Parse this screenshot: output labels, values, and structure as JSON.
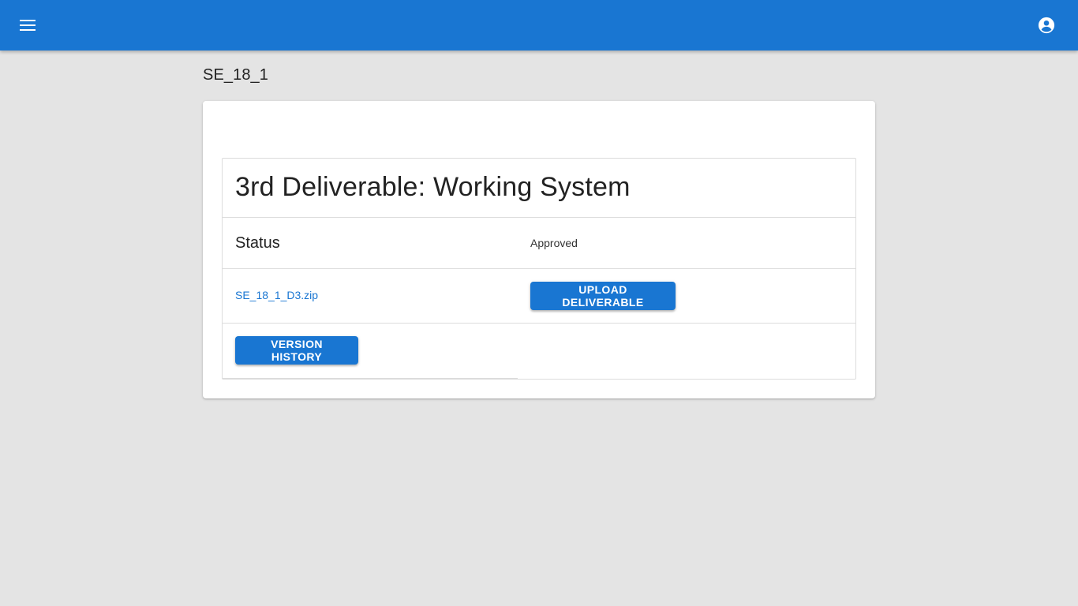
{
  "app_bar": {
    "color": "#1976d2",
    "menu_icon": "hamburger-menu-icon",
    "account_icon": "account-circle-icon"
  },
  "page": {
    "title": "SE_18_1"
  },
  "deliverable": {
    "title": "3rd Deliverable: Working System",
    "status_label": "Status",
    "status_value": "Approved",
    "file_name": "SE_18_1_D3.zip",
    "upload_button_label": "UPLOAD DELIVERABLE",
    "history_button_label": "VERSION HISTORY"
  }
}
